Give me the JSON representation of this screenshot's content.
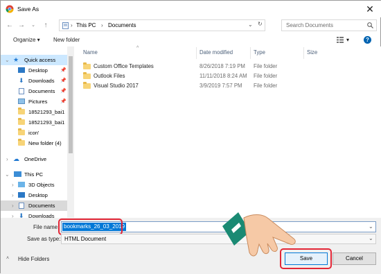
{
  "window": {
    "title": "Save As",
    "close_label": "✕"
  },
  "nav": {
    "back_icon": "arrow-left-icon",
    "forward_icon": "arrow-right-icon",
    "up_icon": "arrow-up-icon",
    "breadcrumb": [
      "This PC",
      "Documents"
    ],
    "search_placeholder": "Search Documents"
  },
  "toolbar": {
    "organize_label": "Organize ▾",
    "new_folder_label": "New folder",
    "view_label": "▾",
    "help_label": "?"
  },
  "sidebar": {
    "items": [
      {
        "label": "Quick access",
        "icon": "star-icon",
        "pinned": false
      },
      {
        "label": "Desktop",
        "icon": "desktop-icon",
        "pinned": true
      },
      {
        "label": "Downloads",
        "icon": "download-icon",
        "pinned": true
      },
      {
        "label": "Documents",
        "icon": "documents-icon",
        "pinned": true
      },
      {
        "label": "Pictures",
        "icon": "pictures-icon",
        "pinned": true
      },
      {
        "label": "18521293_bai1",
        "icon": "folder-icon",
        "pinned": false
      },
      {
        "label": "18521293_bai1",
        "icon": "folder-icon",
        "pinned": false
      },
      {
        "label": "icon'",
        "icon": "folder-icon",
        "pinned": false
      },
      {
        "label": "New folder (4)",
        "icon": "folder-icon",
        "pinned": false
      },
      {
        "label": "OneDrive",
        "icon": "cloud-icon",
        "pinned": false
      },
      {
        "label": "This PC",
        "icon": "computer-icon",
        "pinned": false
      },
      {
        "label": "3D Objects",
        "icon": "cube-icon",
        "pinned": false
      },
      {
        "label": "Desktop",
        "icon": "desktop-icon",
        "pinned": false
      },
      {
        "label": "Documents",
        "icon": "documents-icon",
        "pinned": false
      },
      {
        "label": "Downloads",
        "icon": "download-icon",
        "pinned": false
      }
    ]
  },
  "columns": {
    "name": "Name",
    "date": "Date modified",
    "type": "Type",
    "size": "Size"
  },
  "files": [
    {
      "name": "Custom Office Templates",
      "date": "8/26/2018 7:19 PM",
      "type": "File folder"
    },
    {
      "name": "Outlook Files",
      "date": "11/11/2018 8:24 AM",
      "type": "File folder"
    },
    {
      "name": "Visual Studio 2017",
      "date": "3/9/2019 7:57 PM",
      "type": "File folder"
    }
  ],
  "form": {
    "file_name_label": "File name:",
    "file_name_value": "bookmarks_26_03_2019",
    "save_type_label": "Save as type:",
    "save_type_value": "HTML Document"
  },
  "footer": {
    "hide_folders_label": "Hide Folders",
    "save_label": "Save",
    "cancel_label": "Cancel"
  },
  "colors": {
    "selection": "#cce8ff",
    "highlight": "#e32636",
    "folder": "#f7d478",
    "accent": "#0078d7"
  }
}
